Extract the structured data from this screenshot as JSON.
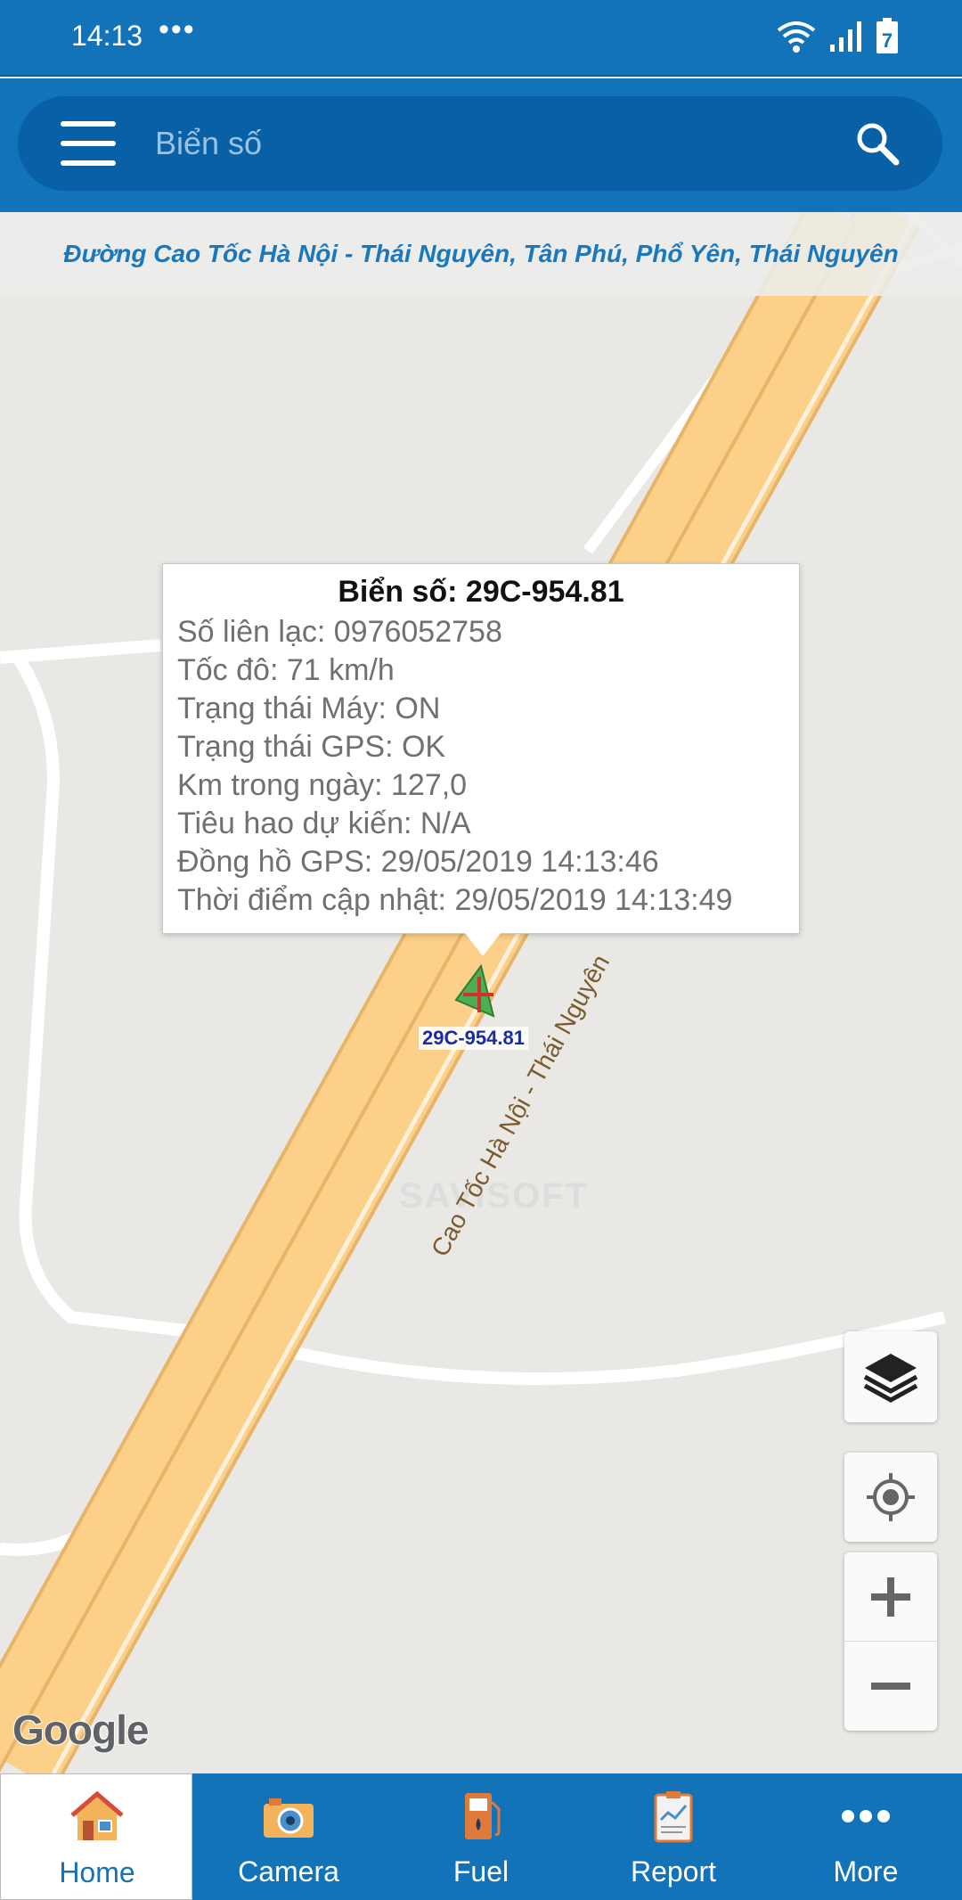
{
  "status_bar": {
    "time": "14:13",
    "dots": "•••",
    "battery_level": "7"
  },
  "search": {
    "placeholder": "Biển số"
  },
  "map": {
    "address": "Đường Cao Tốc Hà Nội - Thái Nguyên, Tân Phú, Phổ Yên, Thái Nguyên",
    "road_label": "Cao Tốc Hà Nội - Thái Nguyên",
    "watermark": "SAVISOFT",
    "google_logo": "Google",
    "vehicle_label": "29C-954.81"
  },
  "info_window": {
    "title": "Biển số: 29C-954.81",
    "lines": [
      "Số liên lạc: 0976052758",
      "Tốc đô: 71 km/h",
      "Trạng thái Máy: ON",
      "Trạng thái GPS: OK",
      "Km trong ngày: 127,0",
      "Tiêu hao dự kiến: N/A",
      "Đồng hồ GPS: 29/05/2019 14:13:46",
      "Thời điểm cập nhật: 29/05/2019 14:13:49"
    ]
  },
  "map_controls": {
    "zoom_in": "+",
    "zoom_out": "−"
  },
  "nav": {
    "items": [
      {
        "label": "Home",
        "icon": "home-icon",
        "active": true
      },
      {
        "label": "Camera",
        "icon": "camera-icon",
        "active": false
      },
      {
        "label": "Fuel",
        "icon": "fuel-pump-icon",
        "active": false
      },
      {
        "label": "Report",
        "icon": "report-icon",
        "active": false
      },
      {
        "label": "More",
        "icon": "more-dots-icon",
        "active": false
      }
    ]
  },
  "colors": {
    "primary": "#1273b8",
    "search_bg": "#0860a6",
    "road": "#fcd089",
    "address_text": "#1a78bf"
  }
}
